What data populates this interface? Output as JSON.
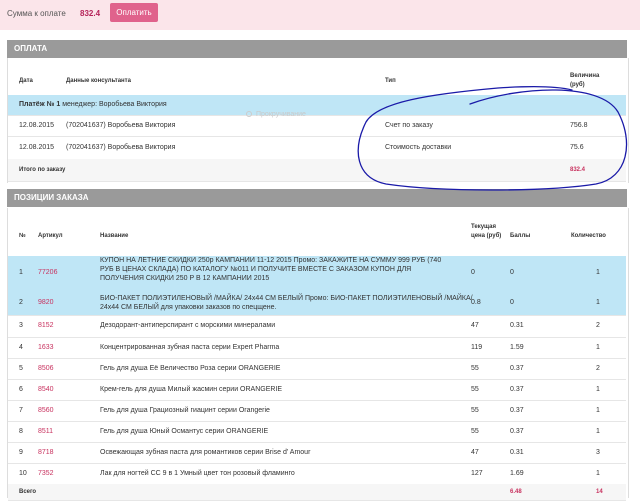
{
  "topbar": {
    "sum_label": "Сумма к оплате",
    "sum_value": "832.4",
    "pay_button": "Оплатить"
  },
  "payment": {
    "section_title": "ОПЛАТА",
    "headers": {
      "date": "Дата",
      "consultant": "Данные консультанта",
      "type": "Тип",
      "amount": "Величина (руб)"
    },
    "group": {
      "label": "Платёж № 1",
      "manager": "менеджер: Воробьева Виктория"
    },
    "rows": [
      {
        "date": "12.08.2015",
        "consultant": "(702041637) Воробьева Виктория",
        "type": "Счет по заказу",
        "amount": "756.8"
      },
      {
        "date": "12.08.2015",
        "consultant": "(702041637) Воробьева Виктория",
        "type": "Стоимость доставки",
        "amount": "75.6"
      }
    ],
    "total_label": "Итого по заказу",
    "total_value": "832.4",
    "ghost_text": "Прокручивание"
  },
  "positions": {
    "section_title": "ПОЗИЦИИ ЗАКАЗА",
    "headers": {
      "num": "№",
      "article": "Артикул",
      "name": "Название",
      "price": "Текущая цена (руб)",
      "points": "Баллы",
      "qty": "Количество"
    },
    "rows": [
      {
        "num": "1",
        "article": "77206",
        "name": "КУПОН НА ЛЕТНИЕ СКИДКИ 250р КАМПАНИИ 11-12 2015 Промо: ЗАКАЖИТЕ НА СУММУ 999 РУБ (740 РУБ В ЦЕНАХ СКЛАДА) ПО КАТАЛОГУ №011 И ПОЛУЧИТЕ ВМЕСТЕ С ЗАКАЗОМ КУПОН ДЛЯ ПОЛУЧЕНИЯ СКИДКИ 250 Р В 12 КАМПАНИИ 2015",
        "price": "0",
        "points": "0",
        "qty": "1"
      },
      {
        "num": "2",
        "article": "9820",
        "name": "БИО-ПАКЕТ ПОЛИЭТИЛЕНОВЫЙ /МАЙКА/ 24х44 СМ БЕЛЫЙ Промо: БИО-ПАКЕТ ПОЛИЭТИЛЕНОВЫЙ /МАЙКА/ 24х44 СМ БЕЛЫЙ для упаковки заказов по спецщене.",
        "price": "0.8",
        "points": "0",
        "qty": "1"
      },
      {
        "num": "3",
        "article": "8152",
        "name": "Дезодорант-антиперспирант с морскими минералами",
        "price": "47",
        "points": "0.31",
        "qty": "2"
      },
      {
        "num": "4",
        "article": "1633",
        "name": "Концентрированная зубная паста серии Expert Pharma",
        "price": "119",
        "points": "1.59",
        "qty": "1"
      },
      {
        "num": "5",
        "article": "8506",
        "name": "Гель для душа Её Величество Роза серии ORANGERIE",
        "price": "55",
        "points": "0.37",
        "qty": "2"
      },
      {
        "num": "6",
        "article": "8540",
        "name": "Крем-гель для душа Милый жасмин серии ORANGERIE",
        "price": "55",
        "points": "0.37",
        "qty": "1"
      },
      {
        "num": "7",
        "article": "8560",
        "name": "Гель для душа Грациозный гиацинт серии Orangerie",
        "price": "55",
        "points": "0.37",
        "qty": "1"
      },
      {
        "num": "8",
        "article": "8511",
        "name": "Гель для душа Юный Османтус серии ORANGERIE",
        "price": "55",
        "points": "0.37",
        "qty": "1"
      },
      {
        "num": "9",
        "article": "8718",
        "name": "Освежающая зубная паста для романтиков серии Brise d' Amour",
        "price": "47",
        "points": "0.31",
        "qty": "3"
      },
      {
        "num": "10",
        "article": "7352",
        "name": "Лак для ногтей СС 9 в 1 Умный цвет тон розовый фламинго",
        "price": "127",
        "points": "1.69",
        "qty": "1"
      }
    ],
    "total_label": "Всего",
    "total_points": "6.48",
    "total_qty": "14"
  },
  "colors": {
    "accent": "#e0628c",
    "highlight_row": "#bfe6f6",
    "section_header": "#9a9a9a",
    "annotation": "#1a1aa8"
  }
}
